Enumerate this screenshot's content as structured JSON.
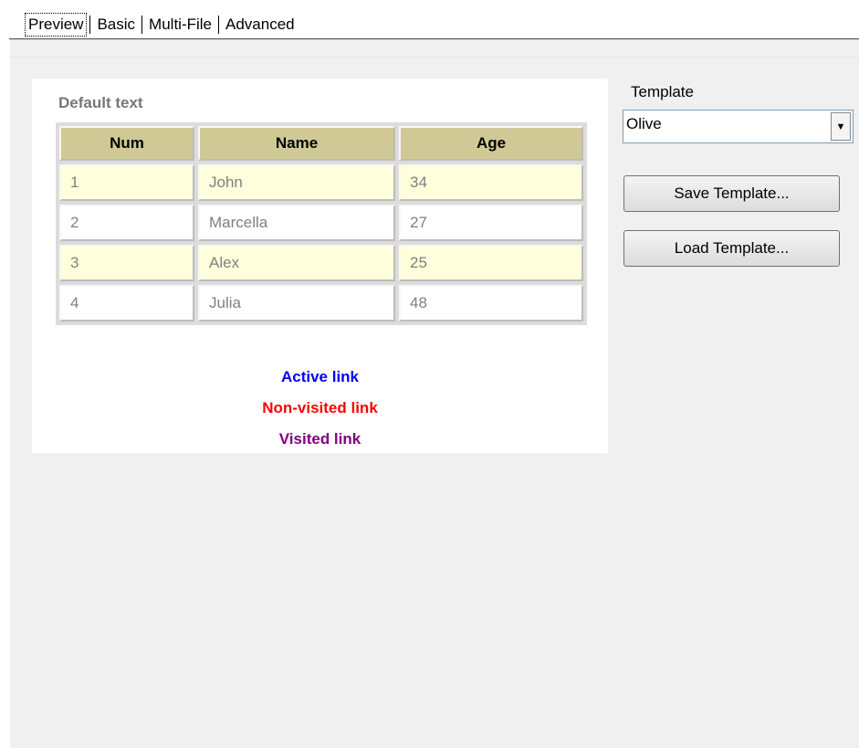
{
  "tabs": [
    {
      "label": "Preview",
      "active": true
    },
    {
      "label": "Basic",
      "active": false
    },
    {
      "label": "Multi-File",
      "active": false
    },
    {
      "label": "Advanced",
      "active": false
    }
  ],
  "preview": {
    "default_text": "Default text",
    "columns": [
      "Num",
      "Name",
      "Age"
    ],
    "rows": [
      [
        "1",
        "John",
        "34"
      ],
      [
        "2",
        "Marcella",
        "27"
      ],
      [
        "3",
        "Alex",
        "25"
      ],
      [
        "4",
        "Julia",
        "48"
      ]
    ],
    "links": {
      "active": "Active link",
      "non_visited": "Non-visited link",
      "visited": "Visited link"
    },
    "colors": {
      "header_bg": "#d0c995",
      "odd_row_bg": "#ffffdb",
      "active_link": "#0000ff",
      "non_visited_link": "#ff0000",
      "visited_link": "#800080"
    }
  },
  "template": {
    "label": "Template",
    "selected": "Olive"
  },
  "buttons": {
    "save": "Save Template...",
    "load": "Load Template..."
  }
}
